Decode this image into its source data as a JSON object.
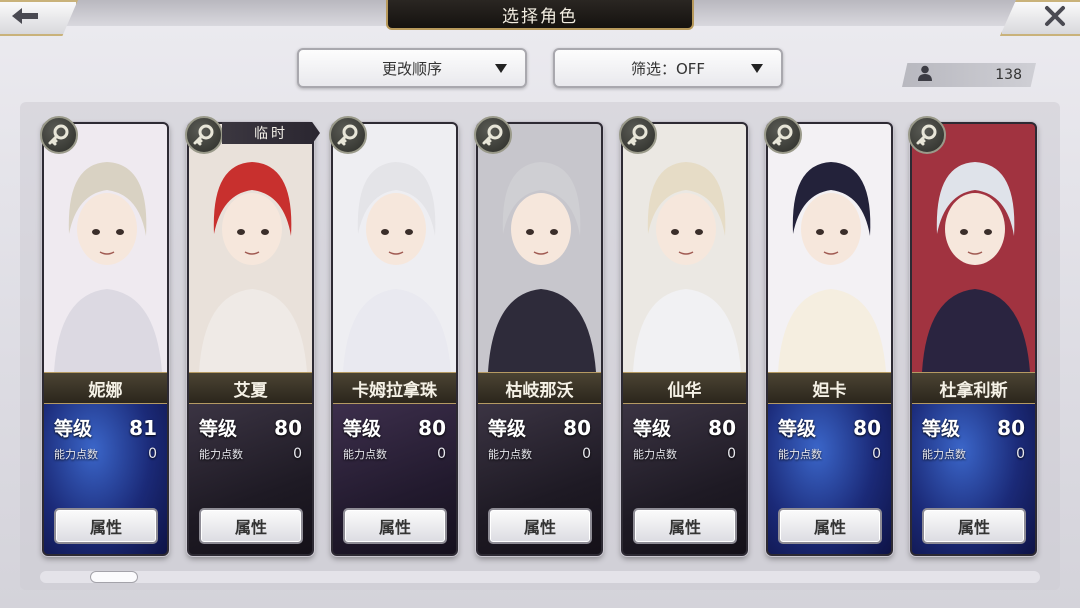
{
  "header": {
    "title": "选择角色",
    "back_icon": "arrow-left-icon",
    "close_icon": "close-x-icon"
  },
  "controls": {
    "order_label": "更改顺序",
    "filter_label": "筛选：OFF",
    "character_count": "138"
  },
  "labels": {
    "level": "等级",
    "ability_points": "能力点数",
    "attribute_button": "属性",
    "temporary": "临时"
  },
  "colors": {
    "accent_gold": "#b89a5c",
    "stat_blue": "#1b2a78",
    "stat_dark": "#1e1a24"
  },
  "characters": [
    {
      "name": "妮娜",
      "level": "81",
      "points": "0",
      "theme": "blue"
    },
    {
      "name": "艾夏",
      "level": "80",
      "points": "0",
      "theme": "dark",
      "temporary": true
    },
    {
      "name": "卡姆拉拿珠",
      "level": "80",
      "points": "0",
      "theme": "purple"
    },
    {
      "name": "枯岐那沃",
      "level": "80",
      "points": "0",
      "theme": "dark"
    },
    {
      "name": "仙华",
      "level": "80",
      "points": "0",
      "theme": "dark"
    },
    {
      "name": "妲卡",
      "level": "80",
      "points": "0",
      "theme": "blue"
    },
    {
      "name": "杜拿利斯",
      "level": "80",
      "points": "0",
      "theme": "blue"
    }
  ],
  "scroll": {
    "position": 0.0
  }
}
